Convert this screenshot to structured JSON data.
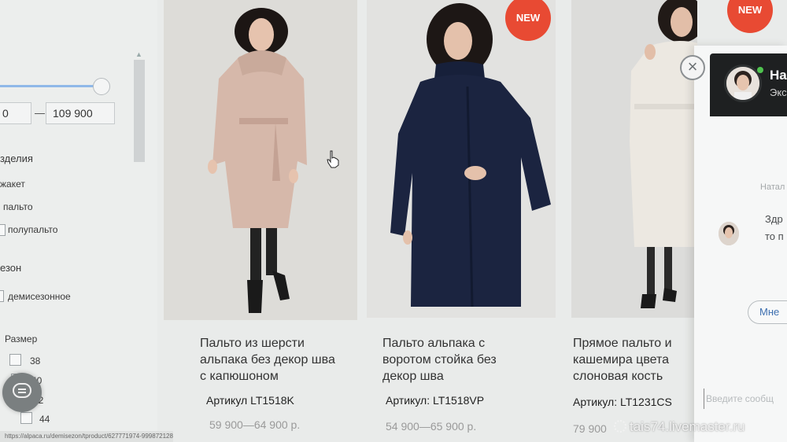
{
  "filters": {
    "price_from": "0",
    "price_dash": "—",
    "price_to": "109 900",
    "type_heading": "зделия",
    "type_options": [
      "жакет",
      "пальто",
      "полупальто"
    ],
    "season_heading": "езон",
    "season_options": [
      "демисезонное"
    ],
    "size_heading": "Размер",
    "sizes": [
      "38",
      "40",
      "42",
      "44"
    ]
  },
  "products": [
    {
      "title_lines": [
        "Пальто из шерсти",
        "альпака без декор шва",
        "с капюшоном"
      ],
      "article": "Артикул LT1518K",
      "price": "59 900—64 900 р.",
      "badge": ""
    },
    {
      "title_lines": [
        "Пальто альпака с",
        "воротом стойка без",
        "декор шва"
      ],
      "article": "Артикул: LT1518VP",
      "price": "54 900—65 900 р.",
      "badge": "NEW"
    },
    {
      "title_lines": [
        "Прямое пальто и",
        "кашемира цвета",
        "слоновая кость"
      ],
      "article": "Артикул: LT1231CS",
      "price": "79 900",
      "badge": "NEW"
    }
  ],
  "chat": {
    "name": "На",
    "subtitle": "Экс",
    "sender": "Натал",
    "message_lines": [
      "Здр",
      "то п"
    ],
    "quick_reply": "Мне",
    "input_placeholder": "Введите сообщ",
    "close_symbol": "×"
  },
  "status_url": "https://alpaca.ru/demisezon/tproduct/627771974-999872128702-palto-iz-sherst-alpaka-bez-dekor-shva",
  "watermark": "tais74.livemaster.ru",
  "colors": {
    "badge": "#e84a33",
    "chat_header": "#1e2021",
    "slider_track": "#8fb8e8",
    "link": "#3d6fb0"
  }
}
